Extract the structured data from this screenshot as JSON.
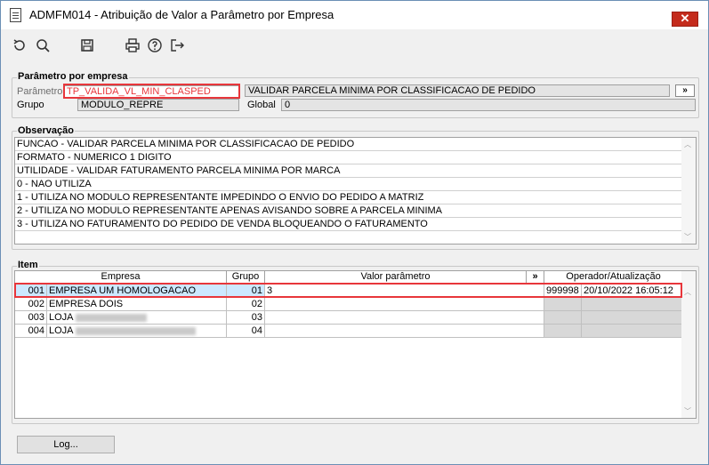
{
  "window": {
    "title": "ADMFM014 - Atribuição de Valor a Parâmetro por Empresa",
    "close_label": "✕"
  },
  "toolbar": {
    "icons": [
      "refresh-icon",
      "search-icon",
      "save-icon",
      "print-icon",
      "help-icon",
      "exit-icon"
    ]
  },
  "parametro_group": {
    "title": "Parâmetro por empresa",
    "parametro_label": "Parâmetro",
    "parametro_value": "TP_VALIDA_VL_MIN_CLASPED",
    "descricao_value": "VALIDAR PARCELA MINIMA POR CLASSIFICACAO DE PEDIDO",
    "more_label": "»",
    "grupo_label": "Grupo",
    "grupo_value": "MODULO_REPRE",
    "global_label": "Global",
    "global_value": "0"
  },
  "observacao": {
    "title": "Observação",
    "lines": [
      "FUNCAO - VALIDAR PARCELA MINIMA POR CLASSIFICACAO DE PEDIDO",
      "FORMATO - NUMERICO 1 DIGITO",
      "UTILIDADE - VALIDAR FATURAMENTO PARCELA MINIMA POR MARCA",
      "0 - NAO UTILIZA",
      "1 - UTILIZA NO MODULO REPRESENTANTE IMPEDINDO O ENVIO DO PEDIDO A MATRIZ",
      "2 - UTILIZA NO MODULO REPRESENTANTE APENAS AVISANDO SOBRE A PARCELA MINIMA",
      "3 - UTILIZA NO FATURAMENTO DO PEDIDO DE VENDA BLOQUEANDO O FATURAMENTO"
    ]
  },
  "item": {
    "title": "Item",
    "headers": {
      "empresa": "Empresa",
      "grupo": "Grupo",
      "valor": "Valor parâmetro",
      "more": "»",
      "operador": "Operador/Atualização"
    },
    "rows": [
      {
        "codigo": "001",
        "empresa": "EMPRESA UM HOMOLOGACAO",
        "grupo": "01",
        "valor": "3",
        "operador": "999998",
        "atualizacao": "20/10/2022 16:05:12"
      },
      {
        "codigo": "002",
        "empresa": "EMPRESA DOIS",
        "grupo": "02",
        "valor": "",
        "operador": "",
        "atualizacao": ""
      },
      {
        "codigo": "003",
        "empresa": "LOJA",
        "grupo": "03",
        "valor": "",
        "operador": "",
        "atualizacao": ""
      },
      {
        "codigo": "004",
        "empresa": "LOJA",
        "grupo": "04",
        "valor": "",
        "operador": "",
        "atualizacao": ""
      }
    ]
  },
  "footer": {
    "log_label": "Log..."
  }
}
